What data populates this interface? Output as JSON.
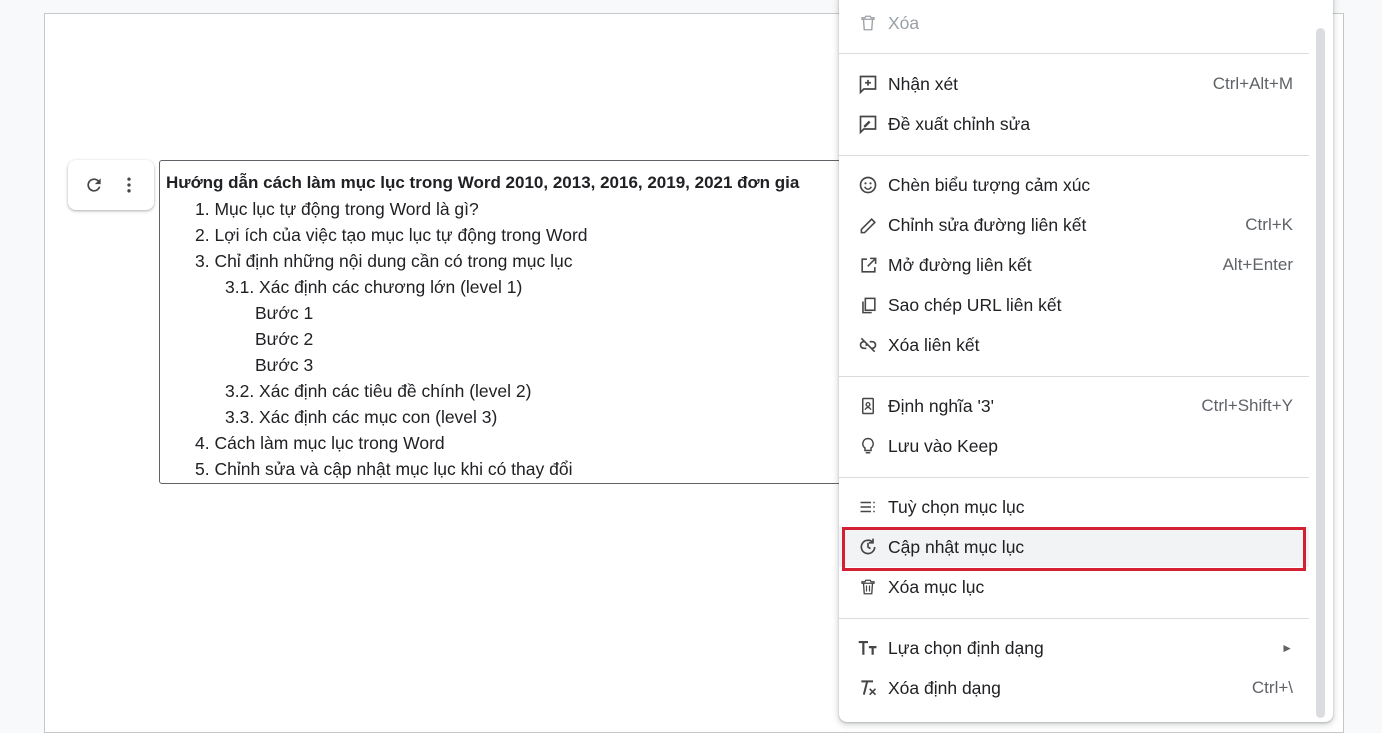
{
  "toc": {
    "title": "Hướng dẫn cách làm mục lục trong Word 2010, 2013, 2016, 2019, 2021 đơn gia",
    "items": [
      "1. Mục lục tự động trong Word là gì?",
      "2. Lợi ích của việc tạo mục lục tự động trong Word",
      "3. Chỉ định những nội dung cần có trong mục lục",
      "3.1. Xác định các chương lớn (level 1)",
      "Bước 1",
      "Bước 2",
      "Bước 3",
      "3.2. Xác định các tiêu đề chính (level 2)",
      "3.3. Xác định các mục con (level 3)",
      "4. Cách làm mục lục trong Word",
      "5. Chỉnh sửa và cập nhật mục lục khi có thay đổi"
    ]
  },
  "toolbar": {
    "refresh_icon": "refresh-icon",
    "more_icon": "more-vert-icon"
  },
  "menu": {
    "items": [
      {
        "label": "Xóa",
        "shortcut": "",
        "icon": "trash-icon",
        "disabled": true
      },
      {
        "label": "Nhận xét",
        "shortcut": "Ctrl+Alt+M",
        "icon": "add-comment-icon"
      },
      {
        "label": "Đề xuất chỉnh sửa",
        "shortcut": "",
        "icon": "suggest-edit-icon"
      },
      {
        "label": "Chèn biểu tượng cảm xúc",
        "shortcut": "",
        "icon": "emoji-icon"
      },
      {
        "label": "Chỉnh sửa đường liên kết",
        "shortcut": "Ctrl+K",
        "icon": "pencil-icon"
      },
      {
        "label": "Mở đường liên kết",
        "shortcut": "Alt+Enter",
        "icon": "open-external-icon"
      },
      {
        "label": "Sao chép URL liên kết",
        "shortcut": "",
        "icon": "copy-icon"
      },
      {
        "label": "Xóa liên kết",
        "shortcut": "",
        "icon": "link-off-icon"
      },
      {
        "label": "Định nghĩa '3'",
        "shortcut": "Ctrl+Shift+Y",
        "icon": "dictionary-icon"
      },
      {
        "label": "Lưu vào Keep",
        "shortcut": "",
        "icon": "lightbulb-icon"
      },
      {
        "label": "Tuỳ chọn mục lục",
        "shortcut": "",
        "icon": "toc-options-icon"
      },
      {
        "label": "Cập nhật mục lục",
        "shortcut": "",
        "icon": "update-icon"
      },
      {
        "label": "Xóa mục lục",
        "shortcut": "",
        "icon": "trash-icon"
      },
      {
        "label": "Lựa chọn định dạng",
        "shortcut": "►",
        "icon": "text-format-icon"
      },
      {
        "label": "Xóa định dạng",
        "shortcut": "Ctrl+\\",
        "icon": "clear-format-icon"
      }
    ],
    "highlight_color": "#d32032"
  }
}
